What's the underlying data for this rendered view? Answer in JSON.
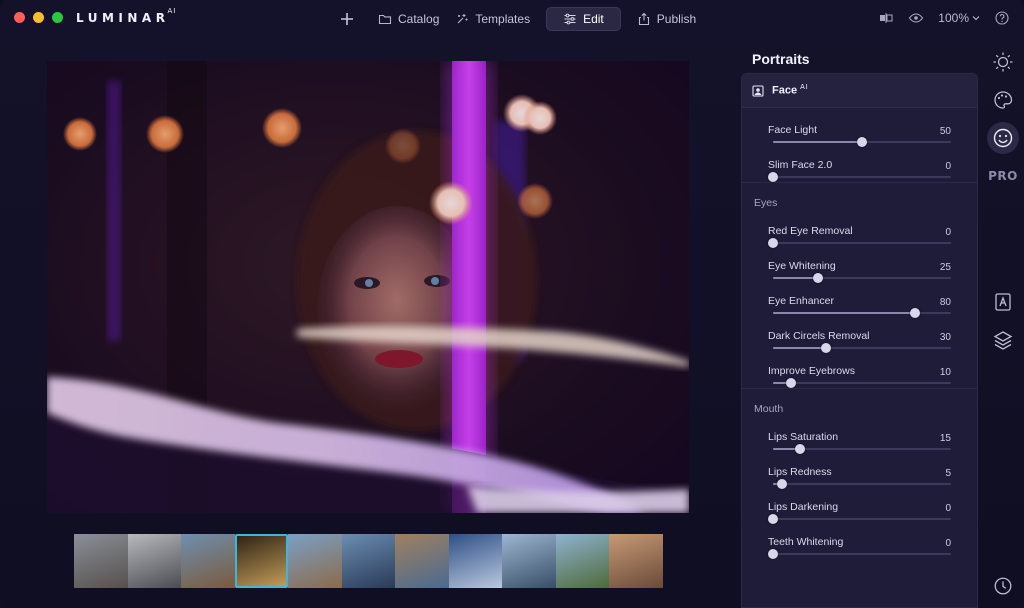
{
  "app": {
    "brand": "LUMINAR",
    "brand_sup": "AI"
  },
  "titlebar": {
    "nav": [
      {
        "label": "Catalog",
        "icon": "folder-icon"
      },
      {
        "label": "Templates",
        "icon": "sparkle-icon"
      },
      {
        "label": "Edit",
        "icon": "sliders-icon",
        "active": true
      },
      {
        "label": "Publish",
        "icon": "share-icon"
      }
    ],
    "zoom": "100%"
  },
  "panel": {
    "title": "Portraits",
    "tool": {
      "label": "Face",
      "sup": "AI"
    },
    "groups": [
      {
        "title": "",
        "sliders": [
          {
            "label": "Face Light",
            "value": 50
          },
          {
            "label": "Slim Face 2.0",
            "value": 0
          }
        ]
      },
      {
        "title": "Eyes",
        "sliders": [
          {
            "label": "Red Eye Removal",
            "value": 0
          },
          {
            "label": "Eye Whitening",
            "value": 25
          },
          {
            "label": "Eye Enhancer",
            "value": 80
          },
          {
            "label": "Dark Circels Removal",
            "value": 30
          },
          {
            "label": "Improve Eyebrows",
            "value": 10
          }
        ]
      },
      {
        "title": "Mouth",
        "sliders": [
          {
            "label": "Lips Saturation",
            "value": 15
          },
          {
            "label": "Lips Redness",
            "value": 5
          },
          {
            "label": "Lips Darkening",
            "value": 0
          },
          {
            "label": "Teeth Whitening",
            "value": 0
          }
        ]
      }
    ]
  },
  "right_tools": {
    "pro_label": "PRO"
  },
  "filmstrip": {
    "selected_index": 3,
    "thumbs": [
      {
        "colors": [
          "#8a8f98",
          "#55504c"
        ]
      },
      {
        "colors": [
          "#b7b9bd",
          "#4b4c52"
        ]
      },
      {
        "colors": [
          "#6f8fb0",
          "#7a5a3c"
        ]
      },
      {
        "colors": [
          "#2a1f14",
          "#c8a05a"
        ]
      },
      {
        "colors": [
          "#7aa0c6",
          "#8c6a4a"
        ]
      },
      {
        "colors": [
          "#6b8db3",
          "#2a3a56"
        ]
      },
      {
        "colors": [
          "#a08060",
          "#4a6a90"
        ]
      },
      {
        "colors": [
          "#2f4f86",
          "#b9c8de"
        ]
      },
      {
        "colors": [
          "#9db6cf",
          "#384e68"
        ]
      },
      {
        "colors": [
          "#8fb3d0",
          "#4e6a3a"
        ]
      },
      {
        "colors": [
          "#c79a76",
          "#6a4a3a"
        ]
      }
    ]
  },
  "colors": {
    "accent_selection": "#3fb6d9",
    "panel_bg": "#1e1c38",
    "window_bg": "#14122a"
  }
}
